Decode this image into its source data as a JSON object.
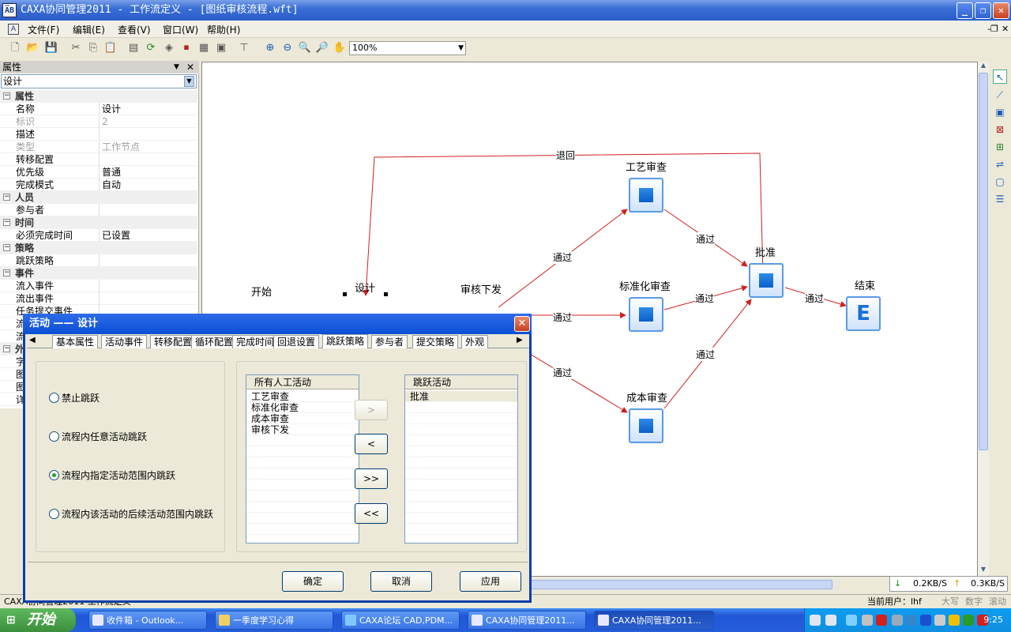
{
  "window": {
    "title": "CAXA协同管理2011 - 工作流定义  - [图纸审核流程.wft]",
    "logo": "A̅B"
  },
  "menu": [
    "文件(F)",
    "编辑(E)",
    "查看(V)",
    "窗口(W)",
    "帮助(H)"
  ],
  "toolbar": {
    "zoom": "100%"
  },
  "properties_panel": {
    "title": "属性",
    "selector": "设计",
    "rows": [
      {
        "k": "属性",
        "cat": true
      },
      {
        "k": "名称",
        "v": "设计"
      },
      {
        "k": "标识",
        "v": "2",
        "disabled": true
      },
      {
        "k": "描述",
        "v": ""
      },
      {
        "k": "类型",
        "v": "工作节点",
        "disabled": true
      },
      {
        "k": "转移配置",
        "v": ""
      },
      {
        "k": "优先级",
        "v": "普通"
      },
      {
        "k": "完成模式",
        "v": "自动"
      },
      {
        "k": "人员",
        "cat": true
      },
      {
        "k": "参与者",
        "v": ""
      },
      {
        "k": "时间",
        "cat": true
      },
      {
        "k": "必须完成时间",
        "v": "已设置"
      },
      {
        "k": "策略",
        "cat": true
      },
      {
        "k": "跳跃策略",
        "v": ""
      },
      {
        "k": "事件",
        "cat": true
      },
      {
        "k": "流入事件",
        "v": ""
      },
      {
        "k": "流出事件",
        "v": ""
      },
      {
        "k": "任务提交事件",
        "v": ""
      },
      {
        "k": "流",
        "v": ""
      },
      {
        "k": "流",
        "v": ""
      },
      {
        "k": "外",
        "cat": true
      },
      {
        "k": "字",
        "v": ""
      },
      {
        "k": "图",
        "v": ""
      },
      {
        "k": "图",
        "v": ""
      },
      {
        "k": "详",
        "v": ""
      }
    ]
  },
  "workflow": {
    "nodes": {
      "start": "开始",
      "design": "设计",
      "review_issue": "审核下发",
      "process_review": "工艺审查",
      "standard_review": "标准化审查",
      "cost_review": "成本审查",
      "approve": "批准",
      "end": "结束"
    },
    "end_glyph": "E",
    "edges": {
      "reject": "退回",
      "pass": "通过",
      "partial": "通过"
    }
  },
  "dialog": {
    "title": "活动 —— 设计",
    "tabs": [
      "基本属性",
      "活动事件",
      "转移配置",
      "循环配置",
      "完成时间",
      "回退设置",
      "跳跃策略",
      "参与者",
      "提交策略",
      "外观"
    ],
    "selected_tab": "跳跃策略",
    "options": [
      {
        "label": "禁止跳跃",
        "checked": false
      },
      {
        "label": "流程内任意活动跳跃",
        "checked": false
      },
      {
        "label": "流程内指定活动范围内跳跃",
        "checked": true
      },
      {
        "label": "流程内该活动的后续活动范围内跳跃",
        "checked": false
      }
    ],
    "all_activities": {
      "header": "所有人工活动",
      "items": [
        "工艺审查",
        "标准化审查",
        "成本审查",
        "审核下发"
      ]
    },
    "jump_activities": {
      "header": "跳跃活动",
      "items": [
        "批准"
      ]
    },
    "move_buttons": [
      ">",
      "<",
      ">>",
      "<<"
    ],
    "buttons": {
      "ok": "确定",
      "cancel": "取消",
      "apply": "应用"
    }
  },
  "status": {
    "left": "CAXA协同管理2011    工作流定义",
    "user": "当前用户：lhf",
    "caps": "大写",
    "num": "数字",
    "scroll": "滚动",
    "down_speed": "0.2KB/S",
    "up_speed": "0.3KB/S"
  },
  "taskbar": {
    "start": "开始",
    "tasks": [
      "收件箱 - Outlook...",
      "一季度学习心得",
      "CAXA论坛 CAD,PDM...",
      "CAXA协同管理2011...",
      "CAXA协同管理2011..."
    ],
    "clock": "9:25"
  }
}
